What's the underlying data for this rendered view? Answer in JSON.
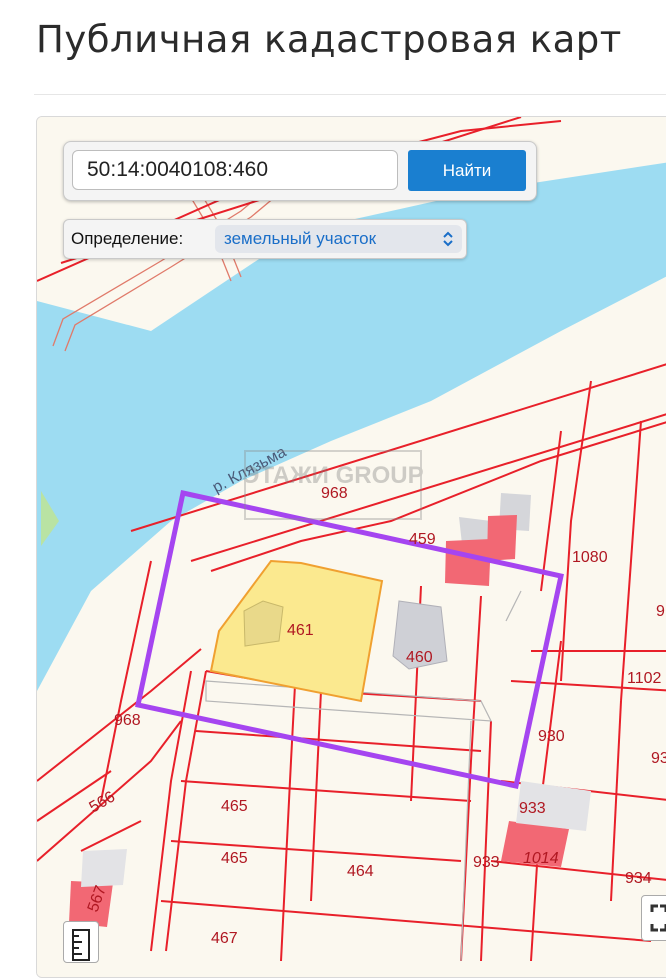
{
  "page": {
    "title": "Публичная кадастровая карт"
  },
  "search": {
    "value": "50:14:0040108:460",
    "button_label": "Найти"
  },
  "definition": {
    "label": "Определение:",
    "selected": "земельный участок"
  },
  "map": {
    "river_label": "р. Клязьма",
    "watermark": "ЭТАЖИ GROUP",
    "parcel_labels": [
      "968",
      "459",
      "1080",
      "461",
      "460",
      "1102",
      "968",
      "930",
      "566",
      "465",
      "933",
      "933",
      "1014",
      "465",
      "464",
      "934",
      "567",
      "467",
      "9",
      "93"
    ],
    "colors": {
      "boundary": "#e8202a",
      "river": "#9ddcf2",
      "selected_parcel": "#fbe98f",
      "highlight": "#a545f0",
      "building": "#cfd0d6",
      "building_red": "#f26874"
    }
  }
}
